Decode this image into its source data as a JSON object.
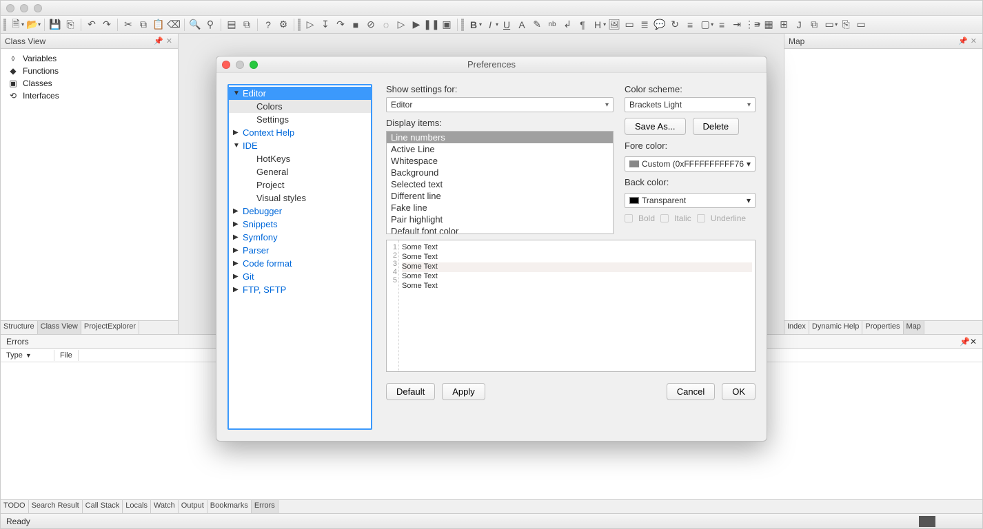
{
  "class_view": {
    "title": "Class View",
    "items": [
      {
        "label": "Variables",
        "icon": "⬨"
      },
      {
        "label": "Functions",
        "icon": "◆"
      },
      {
        "label": "Classes",
        "icon": "▣"
      },
      {
        "label": "Interfaces",
        "icon": "⟲"
      }
    ],
    "tabs": [
      "Structure",
      "Class View",
      "ProjectExplorer"
    ]
  },
  "map": {
    "title": "Map",
    "tabs": [
      "Index",
      "Dynamic Help",
      "Properties",
      "Map"
    ]
  },
  "errors": {
    "title": "Errors",
    "col_type": "Type",
    "col_file": "File",
    "tabs": [
      "TODO",
      "Search Result",
      "Call Stack",
      "Locals",
      "Watch",
      "Output",
      "Bookmarks",
      "Errors"
    ]
  },
  "status": "Ready",
  "dialog": {
    "title": "Preferences",
    "tree": [
      {
        "label": "Editor",
        "expanded": true,
        "children": [
          "Colors",
          "Settings"
        ],
        "selected": 0
      },
      {
        "label": "Context Help",
        "collapsed": true
      },
      {
        "label": "IDE",
        "expanded": true,
        "children": [
          "HotKeys",
          "General",
          "Project",
          "Visual styles"
        ]
      },
      {
        "label": "Debugger",
        "collapsed": true
      },
      {
        "label": "Snippets",
        "collapsed": true
      },
      {
        "label": "Symfony",
        "collapsed": true
      },
      {
        "label": "Parser",
        "collapsed": true
      },
      {
        "label": "Code format",
        "collapsed": true
      },
      {
        "label": "Git",
        "collapsed": true
      },
      {
        "label": "FTP, SFTP",
        "collapsed": true
      }
    ],
    "show_settings_label": "Show settings for:",
    "show_settings_value": "Editor",
    "color_scheme_label": "Color scheme:",
    "color_scheme_value": "Brackets Light",
    "save_as": "Save As...",
    "delete": "Delete",
    "display_items_label": "Display items:",
    "display_items": [
      "Line numbers",
      "Active Line",
      "Whitespace",
      "Background",
      "Selected text",
      "Different line",
      "Fake line",
      "Pair highlight",
      "Default font color"
    ],
    "display_selected": 0,
    "fore_label": "Fore color:",
    "fore_value": "Custom (0xFFFFFFFFFF76",
    "fore_swatch": "#888",
    "back_label": "Back color:",
    "back_value": "Transparent",
    "back_swatch": "#000",
    "bold": "Bold",
    "italic": "Italic",
    "underline": "Underline",
    "preview_lines": [
      "Some Text",
      "Some Text",
      "Some Text",
      "Some Text",
      "Some Text"
    ],
    "buttons": {
      "default": "Default",
      "apply": "Apply",
      "cancel": "Cancel",
      "ok": "OK"
    }
  }
}
